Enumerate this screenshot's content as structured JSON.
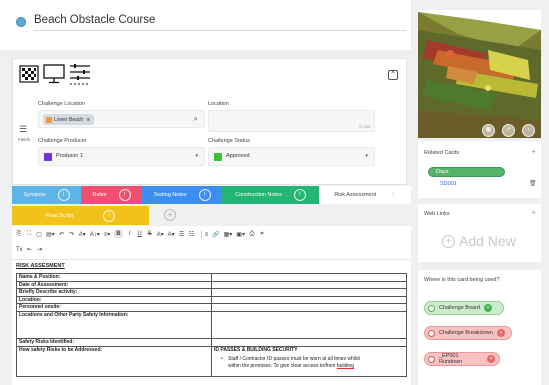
{
  "card": {
    "title": "Beach Obstacle Course"
  },
  "fields": {
    "side_label": "Fields",
    "challenge_location": {
      "label": "Challenge Location",
      "chip": "Lower Beach",
      "chip_close": "⊗"
    },
    "location": {
      "label": "Location",
      "counter": "0 / 255"
    },
    "challenge_producer": {
      "label": "Challenge Producer",
      "value": "Producer 1",
      "color": "#7b2fd6"
    },
    "challenge_status": {
      "label": "Challenge Status",
      "value": "Approved",
      "color": "#36c436"
    }
  },
  "tabs": [
    {
      "label": "Synopsis",
      "badge": "!",
      "color": "#5db4e6"
    },
    {
      "label": "Rules",
      "badge": "!",
      "color": "#f0506e"
    },
    {
      "label": "Testing Notes",
      "badge": "!",
      "color": "#3b8ff2"
    },
    {
      "label": "Construction Notes",
      "badge": "!",
      "color": "#22b573"
    },
    {
      "label": "Risk Assessment",
      "badge": "⋮",
      "color": "#ffffff"
    },
    {
      "label": "Final Script",
      "badge": "!",
      "color": "#f2c21b"
    }
  ],
  "add_tab": "+",
  "toolbar": {
    "row1": [
      "⎘",
      "⛶",
      "▢",
      "▤▾",
      "↶",
      "↷",
      "A▾",
      "A↕▾",
      "≡▾",
      "B",
      "I",
      "U",
      "S",
      "A▾",
      "A▾",
      "☰",
      "☷",
      "⋮≡",
      "🔗",
      "▦▾",
      "▣▾",
      "⎙",
      "⌗"
    ],
    "row2": [
      "Tx",
      "⇤",
      "⇥"
    ]
  },
  "document": {
    "heading": "RISK ASSESMENT",
    "rows": [
      {
        "left": "Name & Position:",
        "right": ""
      },
      {
        "left": "Date of Assessment:",
        "right": ""
      },
      {
        "left": "Briefly Describe activity:",
        "right": ""
      },
      {
        "left": "Location:",
        "right": ""
      },
      {
        "left": "Personnel onsite:",
        "right": ""
      },
      {
        "left": "Locations and Other Party Safety Information:",
        "right": ""
      },
      {
        "left": "Safety Risks Identified:",
        "right": ""
      },
      {
        "left": "How safety Risks to be Addressed:",
        "right": "ID PASSES & BUILDING SECURITY"
      }
    ],
    "bullet_line1": "Staff / Contractor ID passes must be worn at all times whilst",
    "bullet_line2_a": "within the premises. To give clear access to/from ",
    "bullet_line2_b": "building"
  },
  "right": {
    "related_cards": {
      "title": "Related Cards",
      "add": "+",
      "group": "Days",
      "item": "SD001"
    },
    "web_links": {
      "title": "Web Links",
      "add": "+",
      "add_new": "Add New"
    },
    "used": {
      "title": "Where is this card being used?",
      "items": [
        {
          "label": "Challenge Board",
          "state": "green"
        },
        {
          "label": "Challenge Breakdown",
          "state": "red"
        },
        {
          "label": "_EP001 Rundown",
          "state": "red"
        }
      ]
    }
  }
}
